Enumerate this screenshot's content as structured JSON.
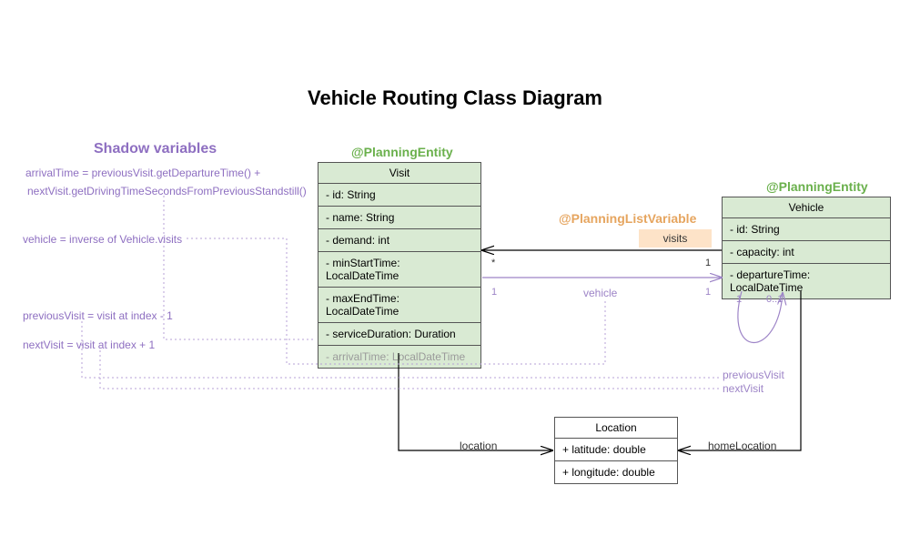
{
  "title": "Vehicle Routing Class Diagram",
  "annotations": {
    "planningEntity1": "@PlanningEntity",
    "planningEntity2": "@PlanningEntity",
    "planningListVariable": "@PlanningListVariable"
  },
  "classes": {
    "visit": {
      "name": "Visit",
      "attrs": [
        "- id: String",
        "- name: String",
        "- demand: int",
        "- minStartTime: LocalDateTime",
        "- maxEndTime: LocalDateTime",
        "- serviceDuration: Duration",
        "- arrivalTime: LocalDateTime"
      ]
    },
    "vehicle": {
      "name": "Vehicle",
      "attrs": [
        "- id: String",
        "- capacity: int",
        "- departureTime: LocalDateTime"
      ]
    },
    "location": {
      "name": "Location",
      "attrs": [
        "+ latitude: double",
        "+ longitude: double"
      ]
    }
  },
  "relations": {
    "visits": {
      "label": "visits",
      "multLeft": "*",
      "multRight": "1"
    },
    "vehicle": {
      "label": "vehicle",
      "multLeft": "1",
      "multRight": "1"
    },
    "location": {
      "label": "location"
    },
    "homeLocation": {
      "label": "homeLocation"
    },
    "previousVisit": {
      "label": "previousVisit",
      "multLeft": "1",
      "multRight": "0..1"
    },
    "nextVisit": {
      "label": "nextVisit"
    }
  },
  "shadow": {
    "heading": "Shadow variables",
    "note1": "arrivalTime = previousVisit.getDepartureTime() +",
    "note2": "nextVisit.getDrivingTimeSecondsFromPreviousStandstill()",
    "note3": "vehicle = inverse of Vehicle.visits",
    "note4": "previousVisit = visit at index - 1",
    "note5": "nextVisit = visit at index + 1"
  }
}
